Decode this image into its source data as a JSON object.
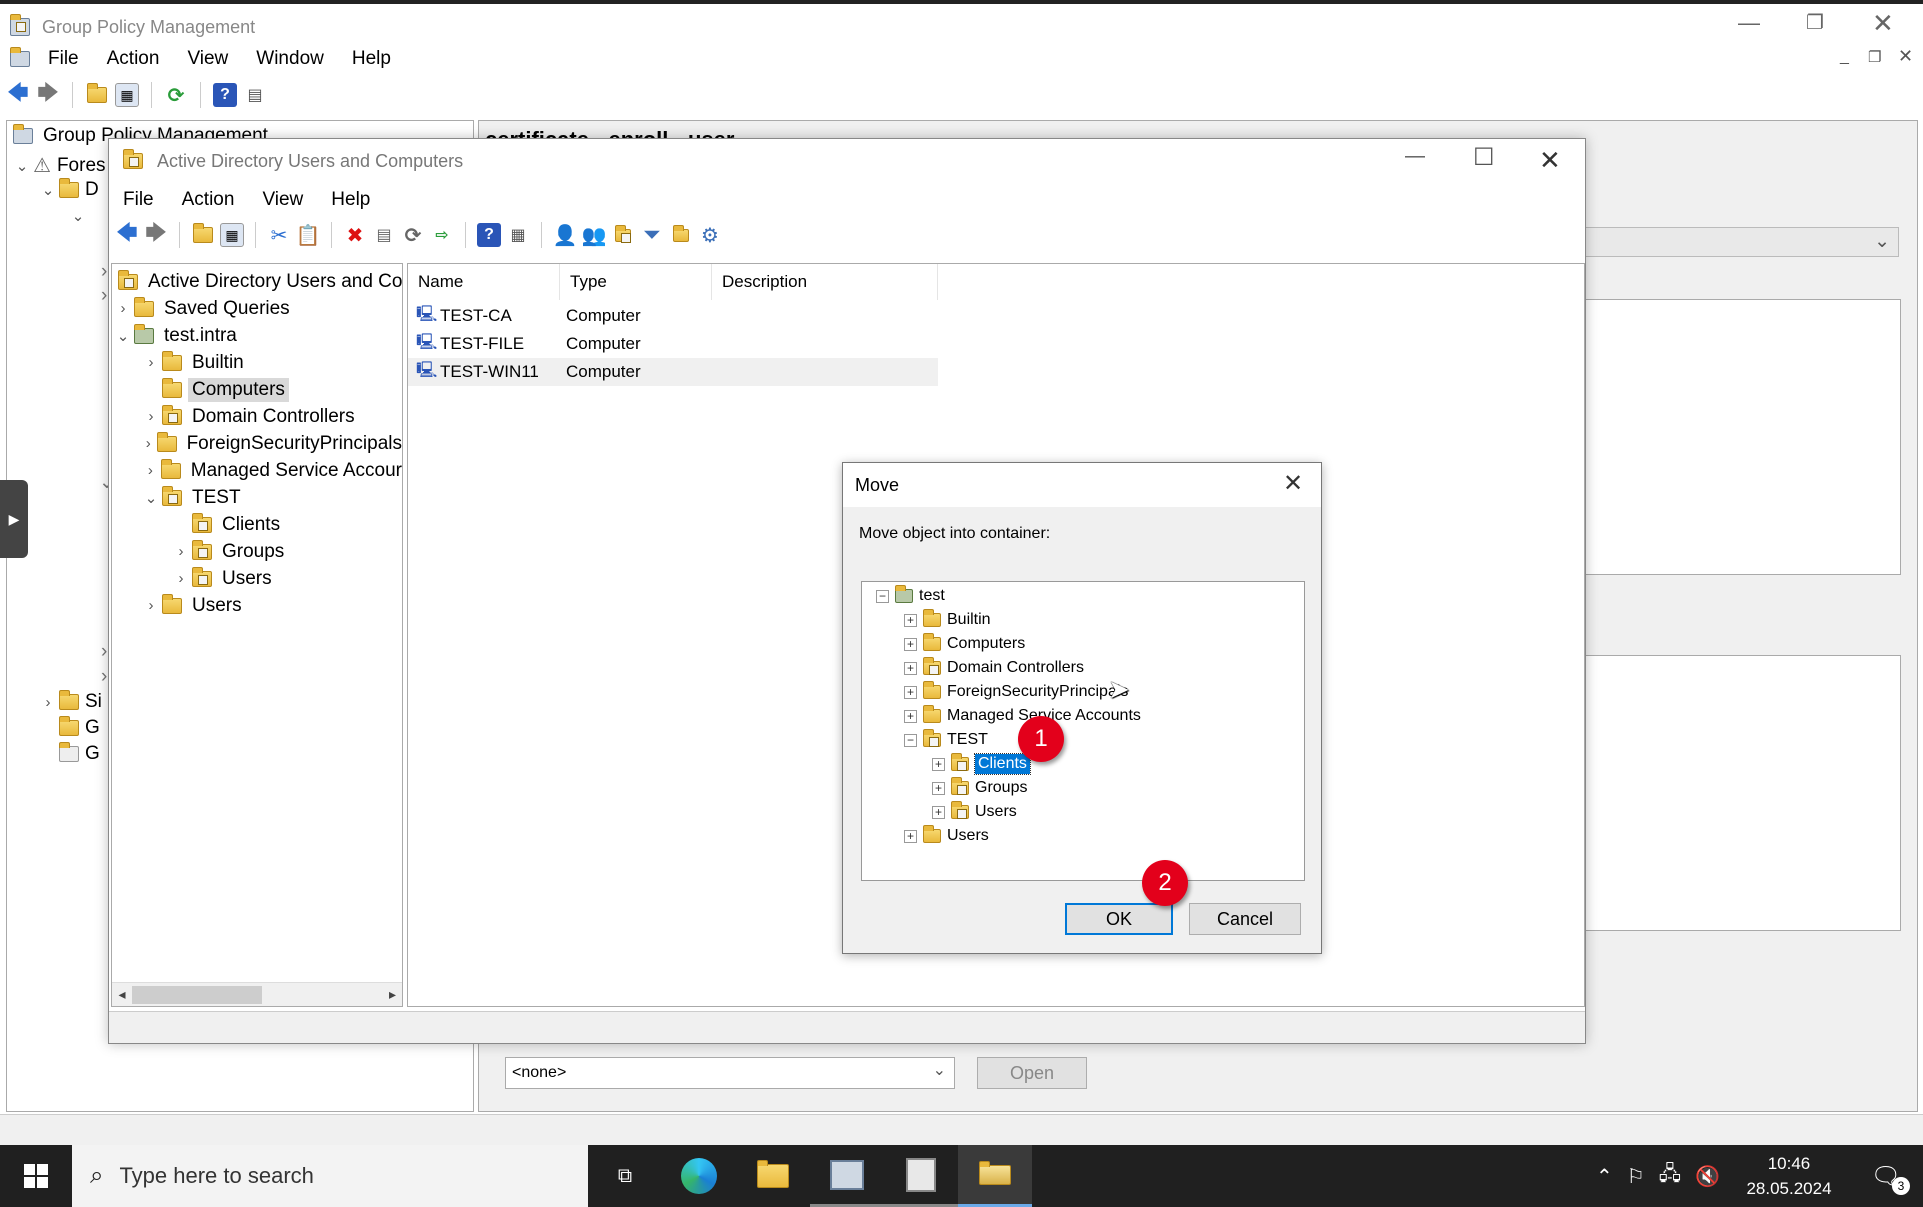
{
  "gpm": {
    "title": "Group Policy Management",
    "menu": [
      "File",
      "Action",
      "View",
      "Window",
      "Help"
    ],
    "tree_root": "Group Policy Management",
    "tree_forest": "Fores",
    "tree_d": "D",
    "tree_si": "Si",
    "tree_g1": "G",
    "tree_g2": "G",
    "right_title": "certificate - enroll - user",
    "wmi_select": "<none>",
    "open_button": "Open"
  },
  "aduc": {
    "title": "Active Directory Users and Computers",
    "menu": [
      "File",
      "Action",
      "View",
      "Help"
    ],
    "tree": {
      "root": "Active Directory Users and Com",
      "saved_queries": "Saved Queries",
      "domain": "test.intra",
      "builtin": "Builtin",
      "computers": "Computers",
      "domain_controllers": "Domain Controllers",
      "fsp": "ForeignSecurityPrincipals",
      "msa": "Managed Service Accour",
      "test": "TEST",
      "clients": "Clients",
      "groups": "Groups",
      "users_sub": "Users",
      "users": "Users"
    },
    "columns": [
      "Name",
      "Type",
      "Description"
    ],
    "rows": [
      {
        "name": "TEST-CA",
        "type": "Computer"
      },
      {
        "name": "TEST-FILE",
        "type": "Computer"
      },
      {
        "name": "TEST-WIN11",
        "type": "Computer"
      }
    ]
  },
  "move": {
    "title": "Move",
    "prompt": "Move object into container:",
    "root": "test",
    "items": [
      "Builtin",
      "Computers",
      "Domain Controllers",
      "ForeignSecurityPrincipals",
      "Managed Service Accounts",
      "TEST"
    ],
    "sub": [
      "Clients",
      "Groups",
      "Users"
    ],
    "last": "Users",
    "ok": "OK",
    "cancel": "Cancel",
    "badge1": "1",
    "badge2": "2"
  },
  "taskbar": {
    "search_placeholder": "Type here to search",
    "time": "10:46",
    "date": "28.05.2024",
    "notif_count": "3"
  },
  "colors": {
    "accent": "#0078d7",
    "badge": "#e3001b",
    "taskbar": "#202020"
  }
}
